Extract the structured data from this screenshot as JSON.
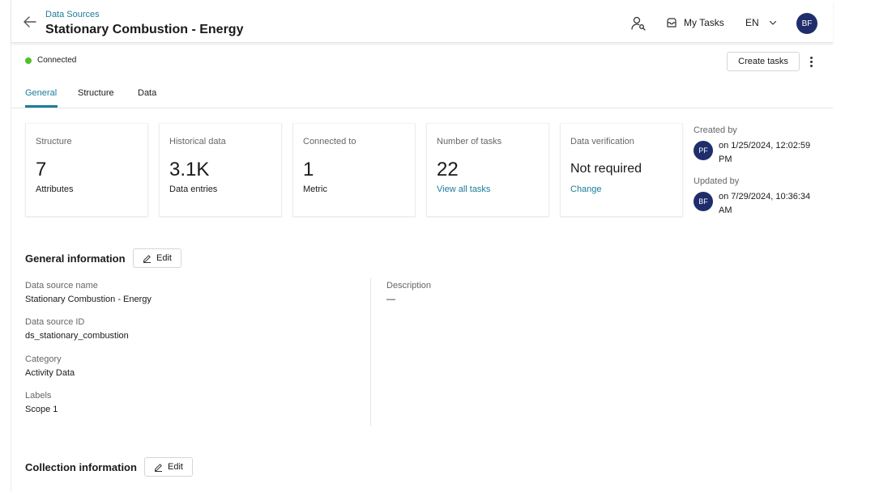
{
  "header": {
    "breadcrumb": "Data Sources",
    "title": "Stationary Combustion - Energy",
    "my_tasks": "My Tasks",
    "language": "EN",
    "user_initials": "BF"
  },
  "status": {
    "text": "Connected",
    "color": "#4fc02c"
  },
  "actions": {
    "create_tasks": "Create tasks"
  },
  "tabs": [
    {
      "label": "General",
      "active": true
    },
    {
      "label": "Structure",
      "active": false
    },
    {
      "label": "Data",
      "active": false
    }
  ],
  "stats": [
    {
      "label": "Structure",
      "value": "7",
      "sub": "Attributes"
    },
    {
      "label": "Historical data",
      "value": "3.1K",
      "sub": "Data entries"
    },
    {
      "label": "Connected to",
      "value": "1",
      "sub": "Metric"
    },
    {
      "label": "Number of tasks",
      "value": "22",
      "sub": "View all tasks"
    },
    {
      "label": "Data verification",
      "value": "Not required",
      "sub": "Change"
    }
  ],
  "meta": {
    "created_label": "Created by",
    "created_initials": "PF",
    "created_text": "on 1/25/2024, 12:02:59 PM",
    "updated_label": "Updated by",
    "updated_initials": "BF",
    "updated_text": "on 7/29/2024, 10:36:34 AM"
  },
  "general": {
    "title": "General information",
    "edit": "Edit",
    "fields": [
      {
        "label": "Data source name",
        "value": "Stationary Combustion - Energy"
      },
      {
        "label": "Data source ID",
        "value": "ds_stationary_combustion"
      },
      {
        "label": "Category",
        "value": "Activity Data"
      },
      {
        "label": "Labels",
        "value": "Scope 1"
      }
    ],
    "description_label": "Description",
    "description_value": "—"
  },
  "collection": {
    "title": "Collection information",
    "edit": "Edit"
  },
  "colors": {
    "accent": "#1b7c9a",
    "avatar": "#1f2d6b"
  }
}
